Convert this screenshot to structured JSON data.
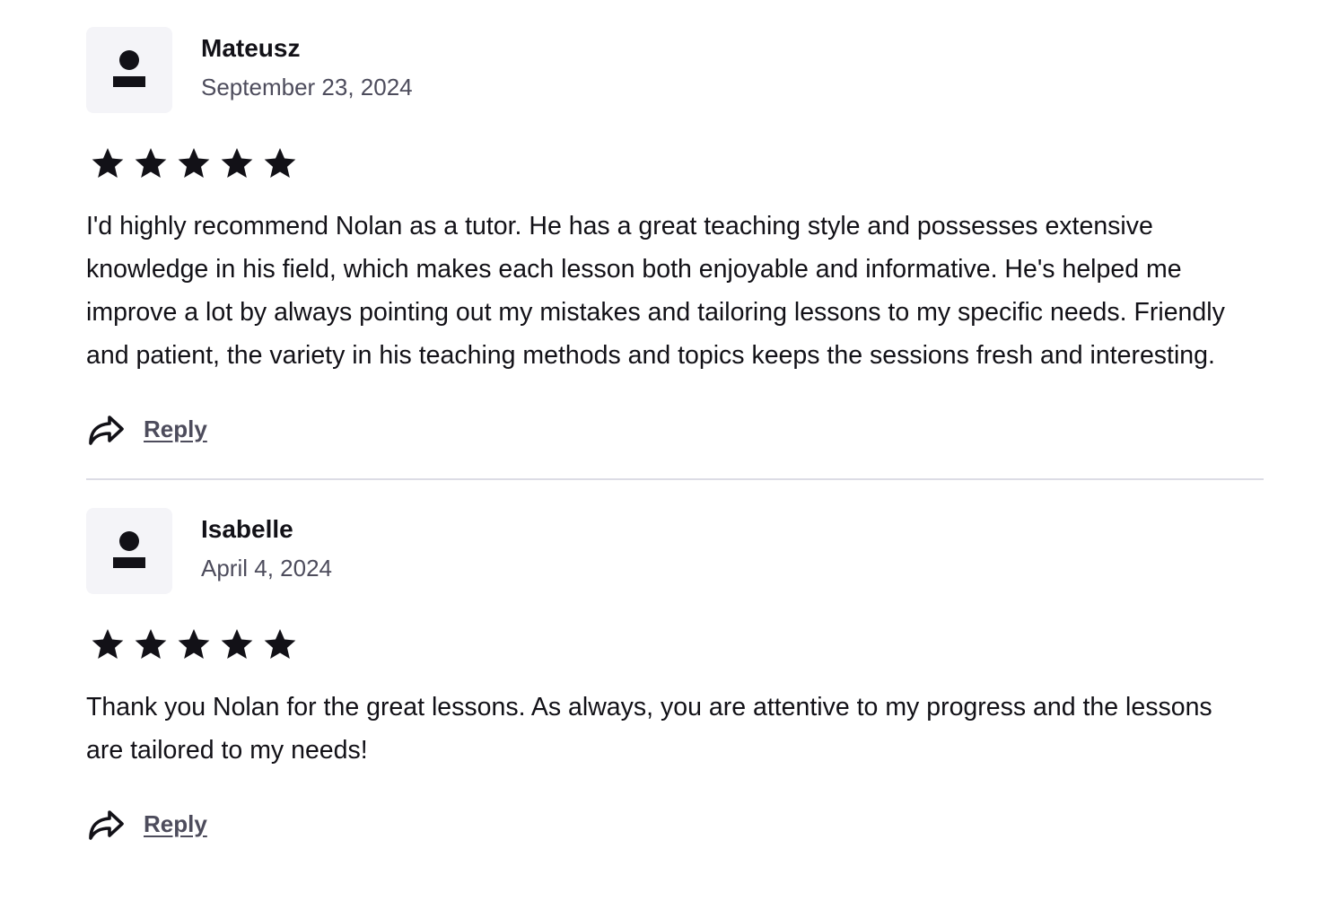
{
  "reviews": [
    {
      "author": "Mateusz",
      "date": "September 23, 2024",
      "rating": 5,
      "text": "I'd highly recommend Nolan as a tutor. He has a great teaching style and possesses extensive knowledge in his field, which makes each lesson both enjoyable and informative. He's helped me improve a lot by always pointing out my mistakes and tailoring lessons to my specific needs. Friendly and patient, the variety in his teaching methods and topics keeps the sessions fresh and interesting.",
      "reply_label": "Reply"
    },
    {
      "author": "Isabelle",
      "date": "April 4, 2024",
      "rating": 5,
      "text": "Thank you Nolan for the great lessons. As always, you are attentive to my progress and the lessons are tailored to my needs!",
      "reply_label": "Reply"
    }
  ],
  "icons": {
    "avatar": "user-placeholder-icon",
    "star": "star-icon",
    "reply": "reply-arrow-icon"
  },
  "colors": {
    "text": "#121117",
    "muted": "#4d4c5c",
    "avatar_bg": "#f4f4f8",
    "divider": "#dcdce5"
  }
}
